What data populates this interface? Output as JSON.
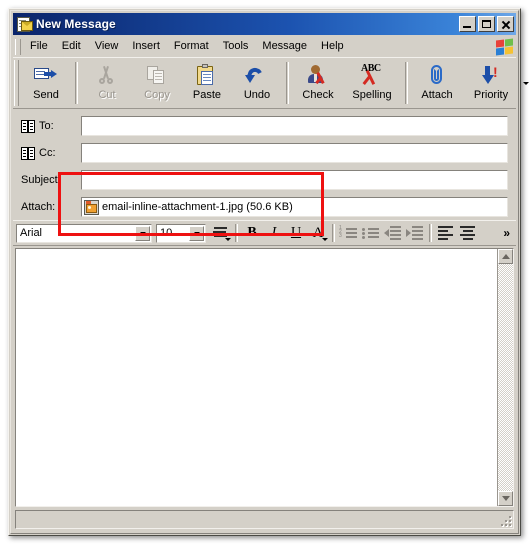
{
  "window": {
    "title": "New Message",
    "icon": "message-document-icon",
    "controls": {
      "minimize": "Minimize",
      "maximize": "Maximize",
      "close": "Close"
    }
  },
  "menubar": {
    "items": [
      {
        "label": "File",
        "name": "menu-file"
      },
      {
        "label": "Edit",
        "name": "menu-edit"
      },
      {
        "label": "View",
        "name": "menu-view"
      },
      {
        "label": "Insert",
        "name": "menu-insert"
      },
      {
        "label": "Format",
        "name": "menu-format"
      },
      {
        "label": "Tools",
        "name": "menu-tools"
      },
      {
        "label": "Message",
        "name": "menu-message"
      },
      {
        "label": "Help",
        "name": "menu-help"
      }
    ],
    "logo": "windows-flag-icon"
  },
  "toolbar": {
    "buttons": [
      {
        "label": "Send",
        "icon": "send-icon",
        "disabled": false
      },
      {
        "label": "Cut",
        "icon": "scissors-icon",
        "disabled": true
      },
      {
        "label": "Copy",
        "icon": "copy-icon",
        "disabled": true
      },
      {
        "label": "Paste",
        "icon": "paste-icon",
        "disabled": false
      },
      {
        "label": "Undo",
        "icon": "undo-icon",
        "disabled": false
      },
      {
        "label": "Check",
        "icon": "check-names-icon",
        "disabled": false
      },
      {
        "label": "Spelling",
        "icon": "spelling-abc-icon",
        "disabled": false
      },
      {
        "label": "Attach",
        "icon": "paperclip-icon",
        "disabled": false
      },
      {
        "label": "Priority",
        "icon": "priority-arrow-icon",
        "disabled": false
      }
    ],
    "priority_dropdown": "chevron-down-icon",
    "overflow": "»"
  },
  "headers": {
    "to": {
      "label": "To:",
      "value": "",
      "icon": "address-book-icon"
    },
    "cc": {
      "label": "Cc:",
      "value": "",
      "icon": "address-book-icon"
    },
    "subject": {
      "label": "Subject:",
      "value": ""
    },
    "attach": {
      "label": "Attach:",
      "file_name": "email-inline-attachment-1.jpg (50.6 KB)",
      "icon": "image-file-icon"
    }
  },
  "format_toolbar": {
    "font": {
      "value": "Arial",
      "dropdown": "chevron-down-icon"
    },
    "size": {
      "value": "10",
      "dropdown": "chevron-down-icon"
    },
    "buttons": [
      {
        "name": "paragraph-style-button",
        "icon": "paragraph-style-icon",
        "glyph": "",
        "disabled": false
      },
      {
        "name": "bold-button",
        "icon": "bold-icon",
        "glyph": "B",
        "disabled": false
      },
      {
        "name": "italic-button",
        "icon": "italic-icon",
        "glyph": "I",
        "disabled": false
      },
      {
        "name": "underline-button",
        "icon": "underline-icon",
        "glyph": "U",
        "disabled": false
      },
      {
        "name": "font-color-button",
        "icon": "font-color-icon",
        "glyph": "A",
        "disabled": false
      },
      {
        "name": "numbered-list-button",
        "icon": "numbered-list-icon",
        "glyph": "",
        "disabled": true
      },
      {
        "name": "bulleted-list-button",
        "icon": "bulleted-list-icon",
        "glyph": "",
        "disabled": true
      },
      {
        "name": "decrease-indent-button",
        "icon": "decrease-indent-icon",
        "glyph": "",
        "disabled": true
      },
      {
        "name": "increase-indent-button",
        "icon": "increase-indent-icon",
        "glyph": "",
        "disabled": true
      },
      {
        "name": "align-left-button",
        "icon": "align-left-icon",
        "glyph": "",
        "disabled": false
      },
      {
        "name": "align-center-button",
        "icon": "align-center-icon",
        "glyph": "",
        "disabled": false
      }
    ],
    "overflow": "»"
  },
  "body": {
    "text": "",
    "scrollbar": {
      "up": "scroll-up-arrow-icon",
      "down": "scroll-down-arrow-icon"
    }
  },
  "statusbar": {
    "text": ""
  },
  "annotation": {
    "color": "#ee1111",
    "shape": "rectangle-highlight"
  }
}
